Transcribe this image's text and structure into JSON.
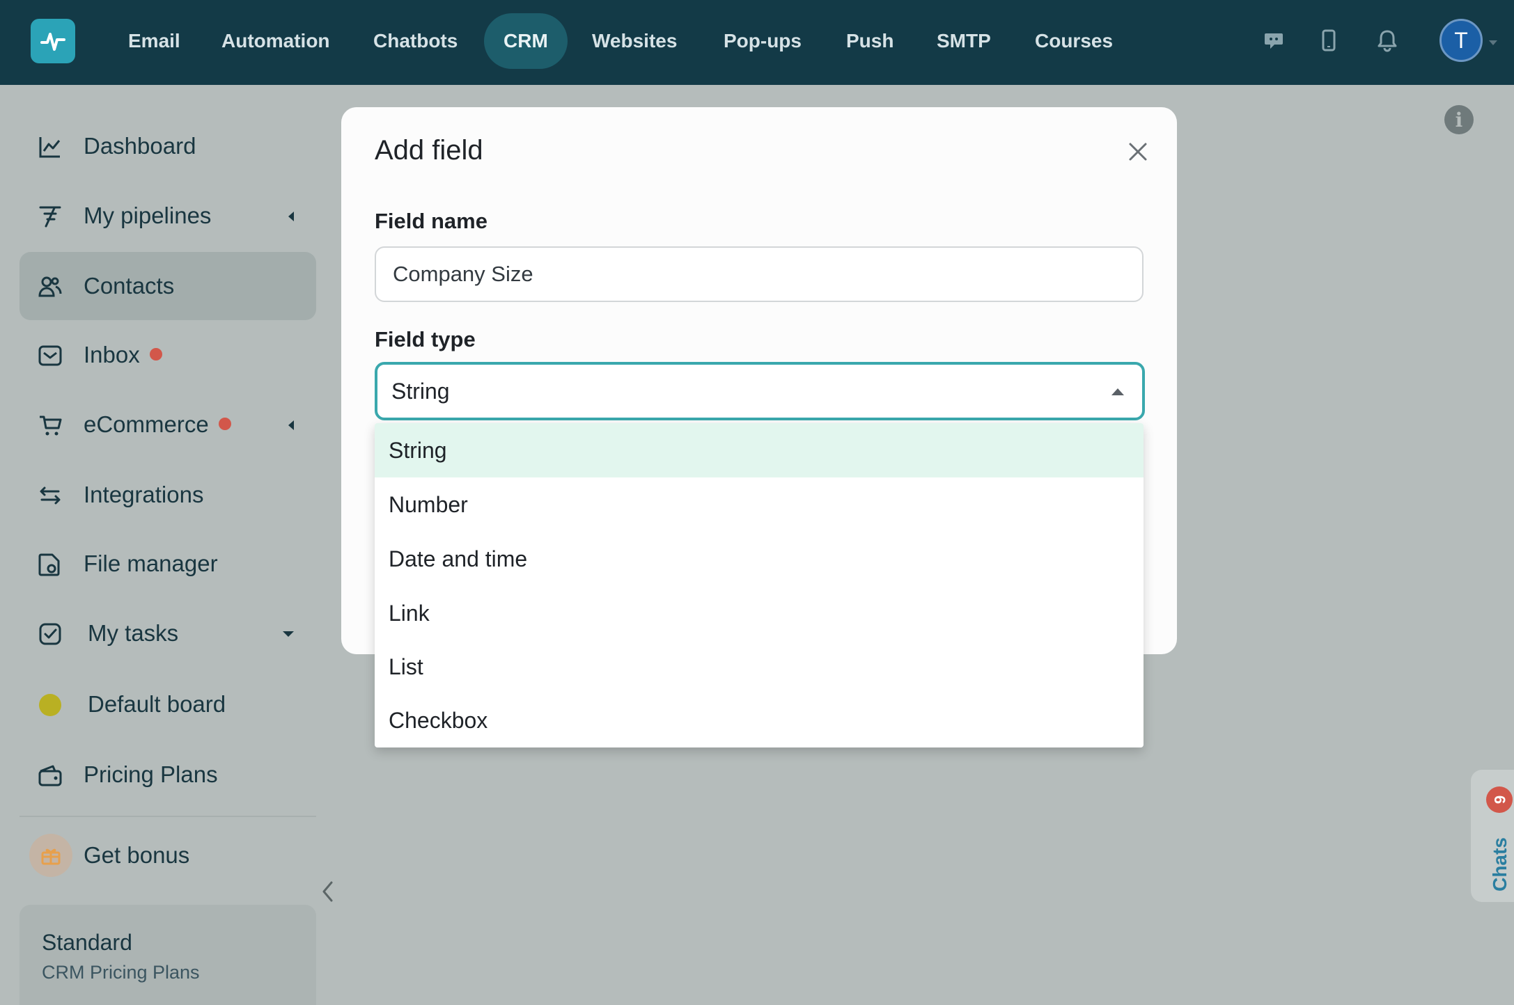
{
  "colors": {
    "topbar": "#133a47",
    "accent": "#2ba3b7",
    "active_nav": "#1d5d6b",
    "focus_border": "#3aa8ad",
    "notification_dot": "#d2574a",
    "selected_option": "#e2f6ee"
  },
  "topnav": {
    "items": [
      {
        "label": "Email"
      },
      {
        "label": "Automation"
      },
      {
        "label": "Chatbots"
      },
      {
        "label": "CRM",
        "active": true
      },
      {
        "label": "Websites"
      },
      {
        "label": "Pop-ups"
      },
      {
        "label": "Push"
      },
      {
        "label": "SMTP"
      },
      {
        "label": "Courses"
      }
    ],
    "icons": [
      "chat-icon",
      "mobile-icon",
      "bell-icon"
    ],
    "avatar_letter": "T"
  },
  "sidebar": {
    "items": [
      {
        "label": "Dashboard",
        "icon": "chart-line-icon"
      },
      {
        "label": "My pipelines",
        "icon": "pipeline-icon"
      },
      {
        "label": "Contacts",
        "icon": "users-icon",
        "active": true
      },
      {
        "label": "Inbox",
        "icon": "inbox-icon",
        "dot": true
      },
      {
        "label": "eCommerce",
        "icon": "cart-icon",
        "dot": true
      },
      {
        "label": "Integrations",
        "icon": "arrows-exchange-icon"
      },
      {
        "label": "File manager",
        "icon": "folder-icon"
      },
      {
        "label": "My tasks",
        "icon": "check-square-icon"
      },
      {
        "label": "Default board",
        "icon": "yellow-dot-icon"
      },
      {
        "label": "Pricing Plans",
        "icon": "wallet-icon"
      }
    ],
    "bonus_label": "Get bonus",
    "plan": {
      "title": "Standard",
      "subtitle": "CRM Pricing Plans"
    }
  },
  "chats": {
    "label": "Chats",
    "badge": "6"
  },
  "modal": {
    "title": "Add field",
    "field_name_label": "Field name",
    "field_name_value": "Company Size",
    "field_type_label": "Field type",
    "field_type_value": "String",
    "options": [
      "String",
      "Number",
      "Date and time",
      "Link",
      "List",
      "Checkbox"
    ],
    "selected_option": "String"
  }
}
